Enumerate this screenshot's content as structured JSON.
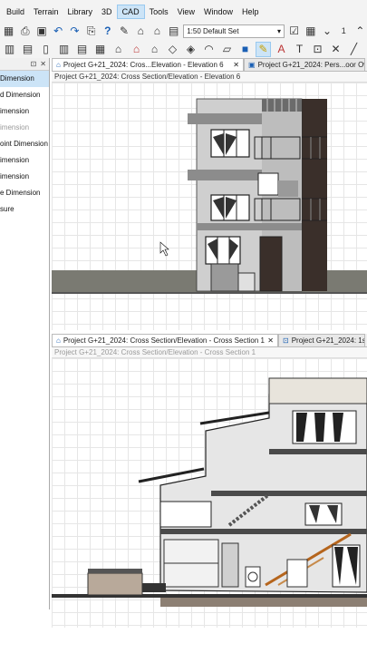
{
  "menubar": {
    "items": [
      "Build",
      "Terrain",
      "Library",
      "3D",
      "CAD",
      "Tools",
      "View",
      "Window",
      "Help"
    ],
    "active": "CAD"
  },
  "toolbar": {
    "scale_select": "1:50 Default Set",
    "counter_value": "1"
  },
  "sidebar": {
    "items": [
      {
        "label": "Dimension",
        "state": "selected"
      },
      {
        "label": "d Dimension",
        "state": "normal"
      },
      {
        "label": "imension",
        "state": "normal"
      },
      {
        "label": "imension",
        "state": "disabled"
      },
      {
        "label": "oint Dimension",
        "state": "normal"
      },
      {
        "label": "imension",
        "state": "normal"
      },
      {
        "label": "imension",
        "state": "normal"
      },
      {
        "label": "e Dimension",
        "state": "normal"
      },
      {
        "label": "sure",
        "state": "normal"
      }
    ]
  },
  "top_pane": {
    "tabs": [
      {
        "label": "Project G+21_2024: Cros...Elevation - Elevation 6",
        "closable": true
      },
      {
        "label": "Project G+21_2024: Pers...oor Ov",
        "closable": false
      }
    ],
    "title": "Project G+21_2024: Cross Section/Elevation - Elevation 6"
  },
  "bottom_pane": {
    "tabs": [
      {
        "label": "Project G+21_2024: Cross Section/Elevation - Cross Section 1",
        "closable": true
      },
      {
        "label": "Project G+21_2024: 1s",
        "closable": false
      }
    ],
    "title": "Project G+21_2024: Cross Section/Elevation - Cross Section 1"
  },
  "colors": {
    "selection": "#cce4f7",
    "chrome": "#f3f3f3",
    "ground": "#7a7a72",
    "wall_grey": "#8c8c8c",
    "brick": "#3a2f2a",
    "slab": "#4a4a4a"
  }
}
